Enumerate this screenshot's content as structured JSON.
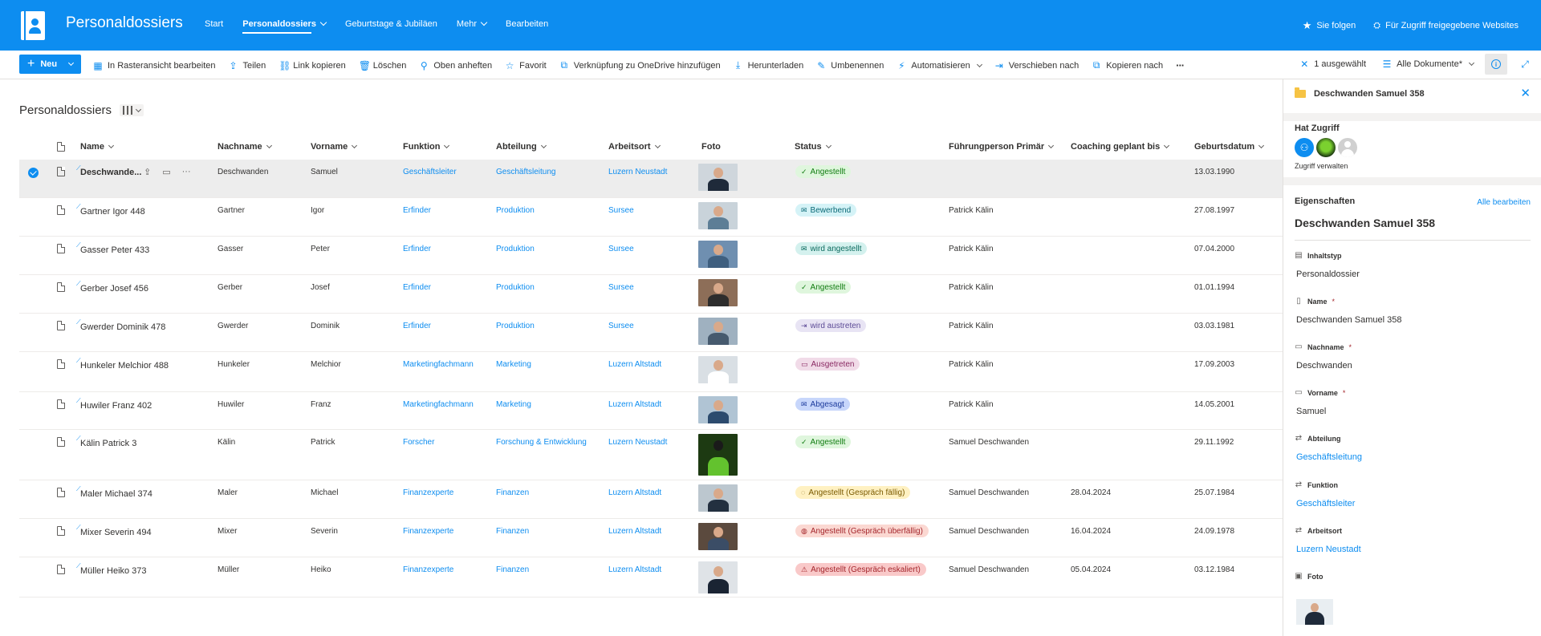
{
  "topbar": {
    "site_title": "Personaldossiers",
    "nav": [
      {
        "label": "Start",
        "active": false,
        "dropdown": false
      },
      {
        "label": "Personaldossiers",
        "active": true,
        "dropdown": true
      },
      {
        "label": "Geburtstage & Jubiläen",
        "active": false,
        "dropdown": false
      },
      {
        "label": "Mehr",
        "active": false,
        "dropdown": true
      },
      {
        "label": "Bearbeiten",
        "active": false,
        "dropdown": false
      }
    ],
    "follow_label": "Sie folgen",
    "shared_label": "Für Zugriff freigegebene Websites"
  },
  "commandbar": {
    "new_label": "Neu",
    "commands": [
      {
        "label": "In Rasteransicht bearbeiten",
        "icon": "grid-icon"
      },
      {
        "label": "Teilen",
        "icon": "share-icon"
      },
      {
        "label": "Link kopieren",
        "icon": "link-icon"
      },
      {
        "label": "Löschen",
        "icon": "trash-icon"
      },
      {
        "label": "Oben anheften",
        "icon": "pin-icon"
      },
      {
        "label": "Favorit",
        "icon": "star-icon"
      },
      {
        "label": "Verknüpfung zu OneDrive hinzufügen",
        "icon": "onedrive-shortcut-icon"
      },
      {
        "label": "Herunterladen",
        "icon": "download-icon"
      },
      {
        "label": "Umbenennen",
        "icon": "rename-icon"
      },
      {
        "label": "Automatisieren",
        "icon": "automate-icon",
        "dropdown": true
      },
      {
        "label": "Verschieben nach",
        "icon": "move-icon"
      },
      {
        "label": "Kopieren nach",
        "icon": "copy-icon"
      },
      {
        "label": "···",
        "icon": "more-icon"
      }
    ],
    "selected_label": "1 ausgewählt",
    "view_label": "Alle Dokumente*"
  },
  "list": {
    "title": "Personaldossiers",
    "columns": [
      {
        "key": "name",
        "label": "Name"
      },
      {
        "key": "nachname",
        "label": "Nachname"
      },
      {
        "key": "vorname",
        "label": "Vorname"
      },
      {
        "key": "funktion",
        "label": "Funktion"
      },
      {
        "key": "abteilung",
        "label": "Abteilung"
      },
      {
        "key": "arbeitsort",
        "label": "Arbeitsort"
      },
      {
        "key": "foto",
        "label": "Foto"
      },
      {
        "key": "status",
        "label": "Status"
      },
      {
        "key": "fuehrung",
        "label": "Führungperson Primär"
      },
      {
        "key": "coaching",
        "label": "Coaching geplant bis"
      },
      {
        "key": "geburtsdatum",
        "label": "Geburtsdatum"
      }
    ],
    "rows": [
      {
        "name": "Deschwande...",
        "nachname": "Deschwanden",
        "vorname": "Samuel",
        "funktion": "Geschäftsleiter",
        "abteilung": "Geschäftsleitung",
        "arbeitsort": "Luzern Neustadt",
        "status": "Angestellt",
        "status_style": "green",
        "status_icon": "person-check-icon",
        "fuehrung": "",
        "coaching": "",
        "geburtsdatum": "13.03.1990",
        "selected": true
      },
      {
        "name": "Gartner Igor 448",
        "nachname": "Gartner",
        "vorname": "Igor",
        "funktion": "Erfinder",
        "abteilung": "Produktion",
        "arbeitsort": "Sursee",
        "status": "Bewerbend",
        "status_style": "cyan",
        "status_icon": "mail-icon",
        "fuehrung": "Patrick Kälin",
        "coaching": "",
        "geburtsdatum": "27.08.1997"
      },
      {
        "name": "Gasser Peter 433",
        "nachname": "Gasser",
        "vorname": "Peter",
        "funktion": "Erfinder",
        "abteilung": "Produktion",
        "arbeitsort": "Sursee",
        "status": "wird angestellt",
        "status_style": "teal",
        "status_icon": "mail-icon",
        "fuehrung": "Patrick Kälin",
        "coaching": "",
        "geburtsdatum": "07.04.2000"
      },
      {
        "name": "Gerber Josef 456",
        "nachname": "Gerber",
        "vorname": "Josef",
        "funktion": "Erfinder",
        "abteilung": "Produktion",
        "arbeitsort": "Sursee",
        "status": "Angestellt",
        "status_style": "green",
        "status_icon": "person-check-icon",
        "fuehrung": "Patrick Kälin",
        "coaching": "",
        "geburtsdatum": "01.01.1994"
      },
      {
        "name": "Gwerder Dominik 478",
        "nachname": "Gwerder",
        "vorname": "Dominik",
        "funktion": "Erfinder",
        "abteilung": "Produktion",
        "arbeitsort": "Sursee",
        "status": "wird austreten",
        "status_style": "lavender",
        "status_icon": "exit-icon",
        "fuehrung": "Patrick Kälin",
        "coaching": "",
        "geburtsdatum": "03.03.1981"
      },
      {
        "name": "Hunkeler Melchior 488",
        "nachname": "Hunkeler",
        "vorname": "Melchior",
        "funktion": "Marketingfachmann",
        "abteilung": "Marketing",
        "arbeitsort": "Luzern Altstadt",
        "status": "Ausgetreten",
        "status_style": "pink",
        "status_icon": "archive-icon",
        "fuehrung": "Patrick Kälin",
        "coaching": "",
        "geburtsdatum": "17.09.2003"
      },
      {
        "name": "Huwiler Franz 402",
        "nachname": "Huwiler",
        "vorname": "Franz",
        "funktion": "Marketingfachmann",
        "abteilung": "Marketing",
        "arbeitsort": "Luzern Altstadt",
        "status": "Abgesagt",
        "status_style": "blue",
        "status_icon": "mail-icon",
        "fuehrung": "Patrick Kälin",
        "coaching": "",
        "geburtsdatum": "14.05.2001"
      },
      {
        "name": "Kälin Patrick 3",
        "nachname": "Kälin",
        "vorname": "Patrick",
        "funktion": "Forscher",
        "abteilung": "Forschung & Entwicklung",
        "arbeitsort": "Luzern Neustadt",
        "status": "Angestellt",
        "status_style": "green",
        "status_icon": "person-check-icon",
        "fuehrung": "Samuel Deschwanden",
        "coaching": "",
        "geburtsdatum": "29.11.1992"
      },
      {
        "name": "Maler Michael 374",
        "nachname": "Maler",
        "vorname": "Michael",
        "funktion": "Finanzexperte",
        "abteilung": "Finanzen",
        "arbeitsort": "Luzern Altstadt",
        "status": "Angestellt (Gespräch fällig)",
        "status_style": "yellow",
        "status_icon": "chat-icon",
        "fuehrung": "Samuel Deschwanden",
        "coaching": "28.04.2024",
        "geburtsdatum": "25.07.1984"
      },
      {
        "name": "Mixer Severin 494",
        "nachname": "Mixer",
        "vorname": "Severin",
        "funktion": "Finanzexperte",
        "abteilung": "Finanzen",
        "arbeitsort": "Luzern Altstadt",
        "status": "Angestellt (Gespräch überfällig)",
        "status_style": "salmon",
        "status_icon": "chat-alert-icon",
        "fuehrung": "Samuel Deschwanden",
        "coaching": "16.04.2024",
        "geburtsdatum": "24.09.1978"
      },
      {
        "name": "Müller Heiko 373",
        "nachname": "Müller",
        "vorname": "Heiko",
        "funktion": "Finanzexperte",
        "abteilung": "Finanzen",
        "arbeitsort": "Luzern Altstadt",
        "status": "Angestellt (Gespräch eskaliert)",
        "status_style": "red",
        "status_icon": "warning-icon",
        "fuehrung": "Samuel Deschwanden",
        "coaching": "05.04.2024",
        "geburtsdatum": "03.12.1984"
      }
    ]
  },
  "pane": {
    "title": "Deschwanden Samuel 358",
    "access_heading": "Hat Zugriff",
    "manage_access": "Zugriff verwalten",
    "properties_heading": "Eigenschaften",
    "edit_all": "Alle bearbeiten",
    "item_name": "Deschwanden Samuel 358",
    "properties": [
      {
        "label": "Inhaltstyp",
        "value": "Personaldossier",
        "required": false,
        "link": false,
        "icon": "content-type-icon"
      },
      {
        "label": "Name",
        "value": "Deschwanden Samuel 358",
        "required": true,
        "link": false,
        "icon": "document-icon"
      },
      {
        "label": "Nachname",
        "value": "Deschwanden",
        "required": true,
        "link": false,
        "icon": "text-field-icon"
      },
      {
        "label": "Vorname",
        "value": "Samuel",
        "required": true,
        "link": false,
        "icon": "text-field-icon"
      },
      {
        "label": "Abteilung",
        "value": "Geschäftsleitung",
        "required": false,
        "link": true,
        "icon": "lookup-icon"
      },
      {
        "label": "Funktion",
        "value": "Geschäftsleiter",
        "required": false,
        "link": true,
        "icon": "lookup-icon"
      },
      {
        "label": "Arbeitsort",
        "value": "Luzern Neustadt",
        "required": false,
        "link": true,
        "icon": "lookup-icon"
      },
      {
        "label": "Foto",
        "value": "",
        "required": false,
        "link": false,
        "icon": "image-icon"
      }
    ],
    "required_mark": "*"
  },
  "colors": {
    "brand": "#0d8df0",
    "selected_row": "#ededed"
  }
}
